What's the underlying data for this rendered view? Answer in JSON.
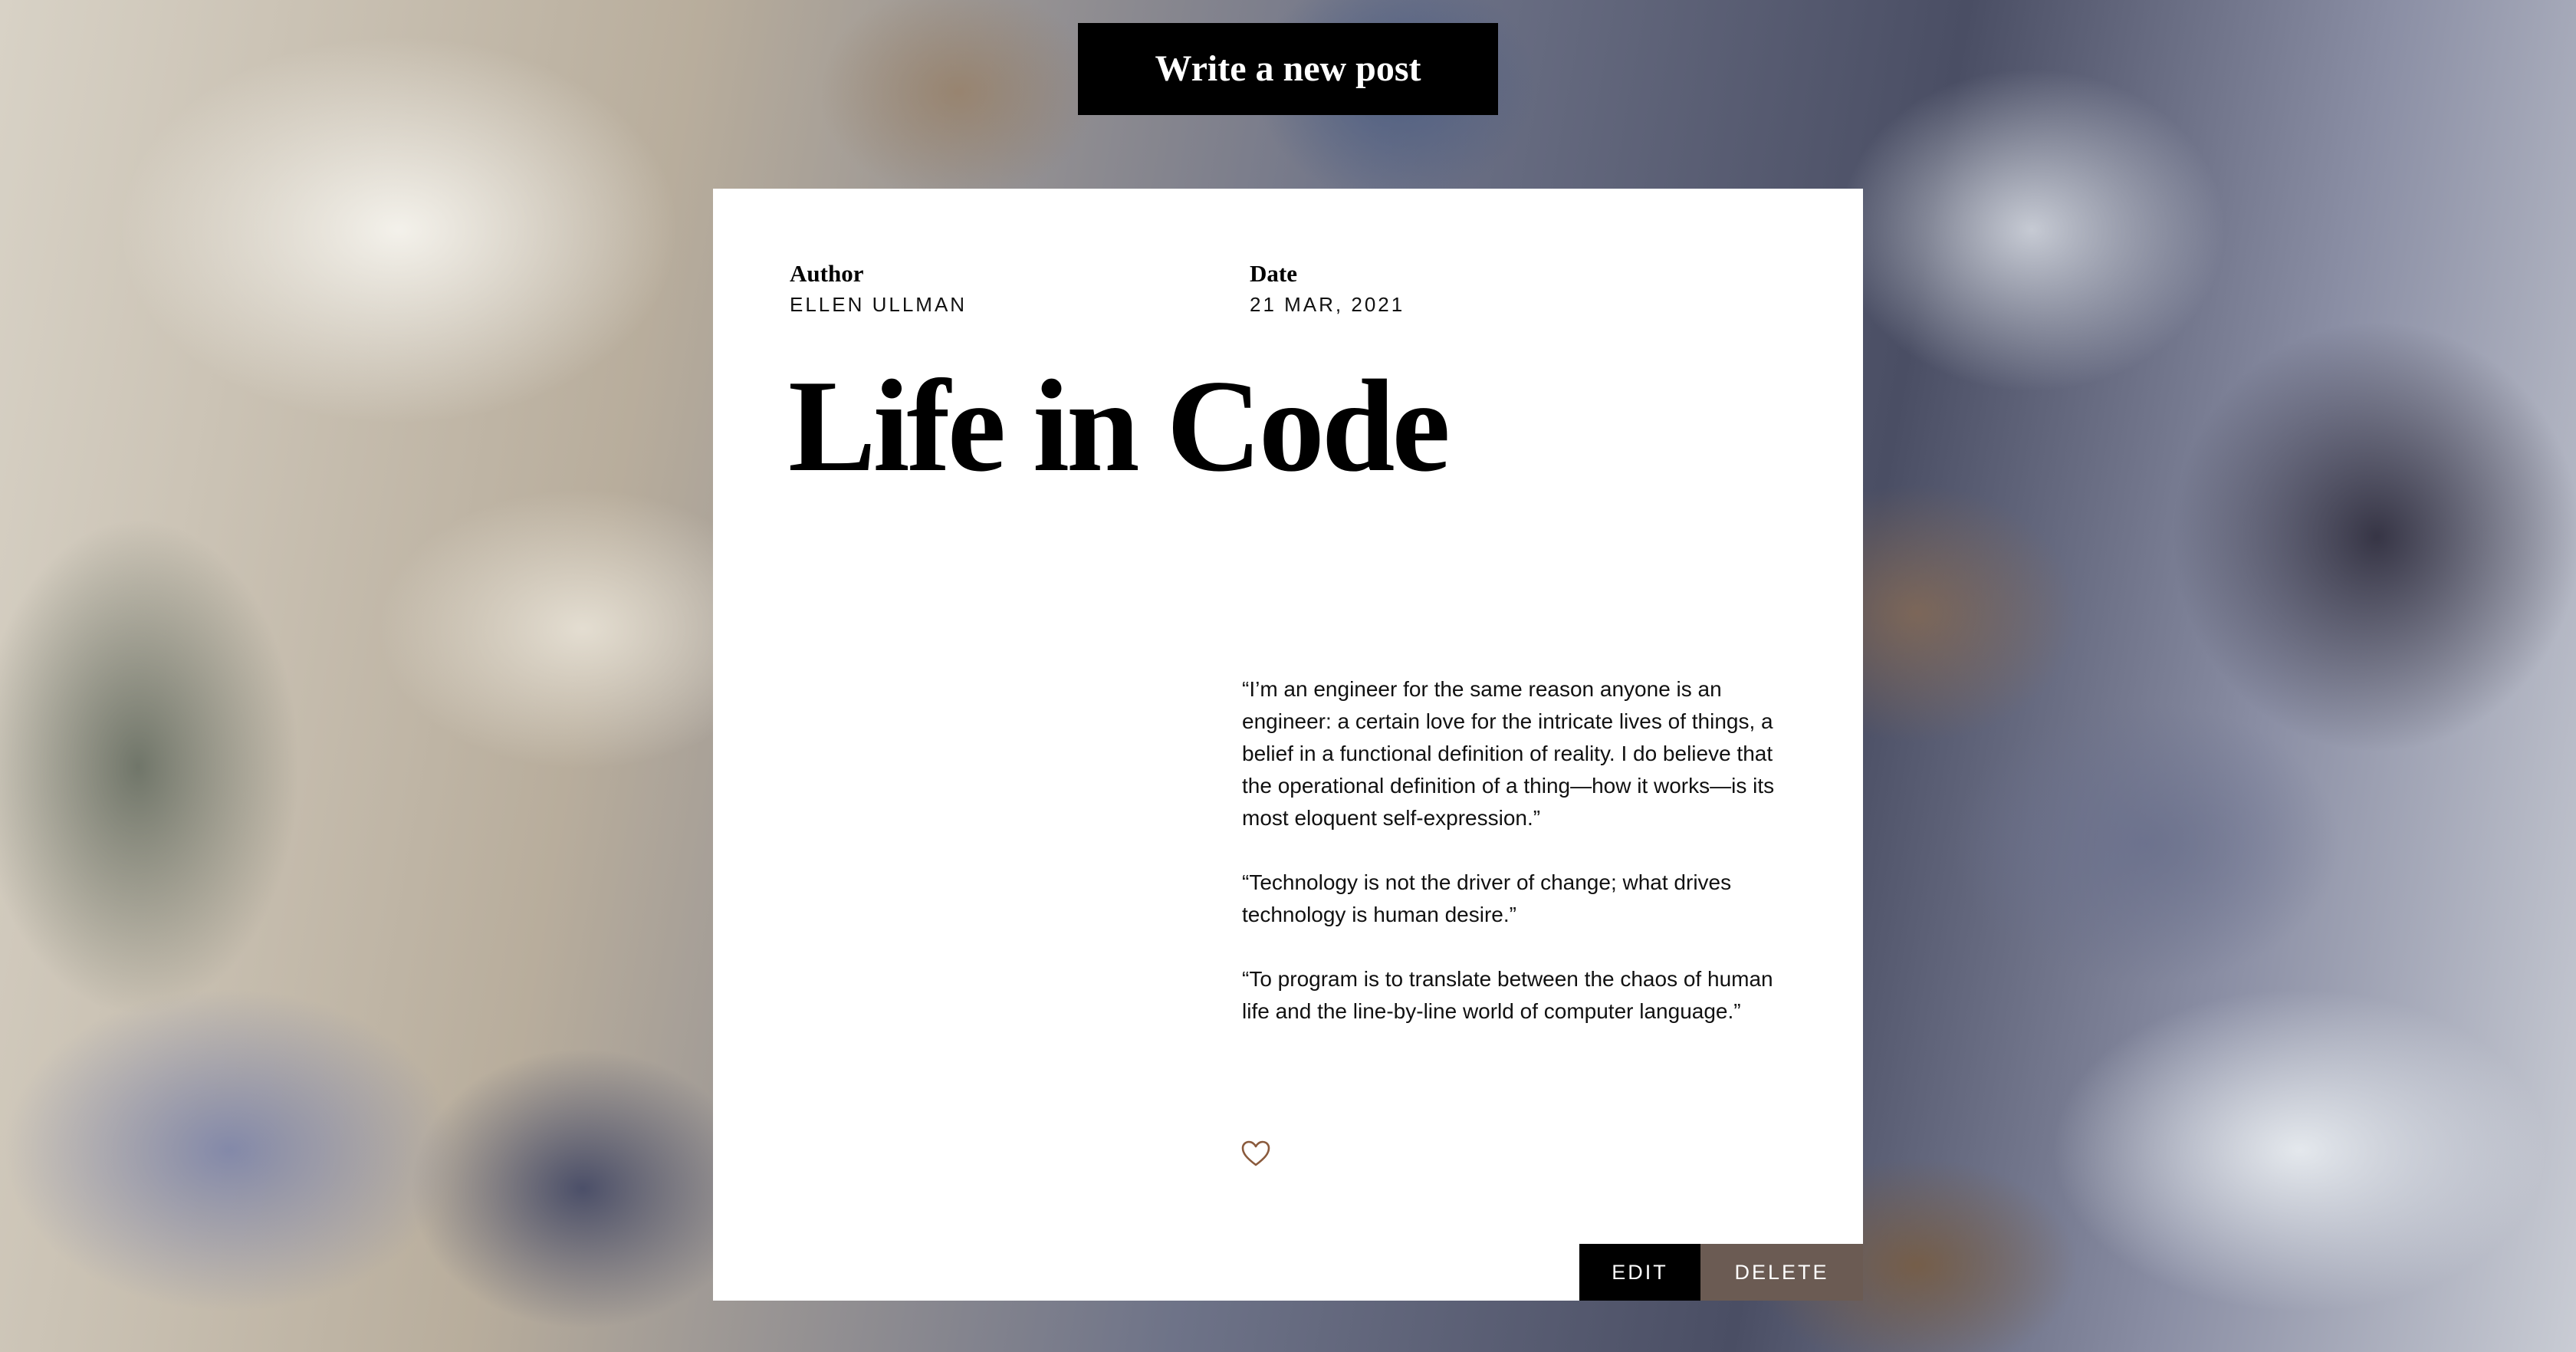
{
  "header": {
    "write_button_label": "Write a new post"
  },
  "post": {
    "author_label": "Author",
    "author_name": "ELLEN ULLMAN",
    "date_label": "Date",
    "date_value": "21 MAR, 2021",
    "title": "Life in Code",
    "paragraphs": [
      "“I’m an engineer for the same reason anyone is an engineer: a certain love for the intricate lives of things, a belief in a functional definition of reality. I do believe that the operational definition of a thing—how it works—is its most eloquent self-expression.”",
      "“Technology is not the driver of change; what drives technology is human desire.”",
      "“To program is to translate between the chaos of human life and the line-by-line world of computer language.”"
    ],
    "like_icon": "heart-icon"
  },
  "actions": {
    "edit_label": "EDIT",
    "delete_label": "DELETE"
  },
  "colors": {
    "button_black": "#000000",
    "delete_button": "#6b5b53",
    "heart_stroke": "#8a5a3c",
    "card_background": "#ffffff"
  }
}
